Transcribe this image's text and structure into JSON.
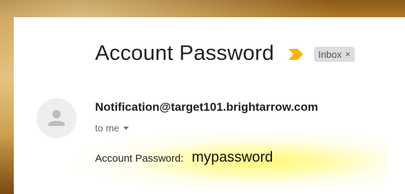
{
  "email": {
    "subject": "Account Password",
    "label_chip": "Inbox",
    "label_chip_close": "×",
    "sender": "Notification@target101.brightarrow.com",
    "recipient": "to me",
    "body_label": "Account Password:",
    "body_value": "mypassword"
  },
  "icons": {
    "importance": "importance-marker-icon",
    "avatar": "person-icon",
    "recipient_details": "chevron-down-icon",
    "chip_close": "close-icon"
  },
  "colors": {
    "importance": "#f4b400",
    "highlight": "#fff86e",
    "frame": "#c99a44"
  }
}
